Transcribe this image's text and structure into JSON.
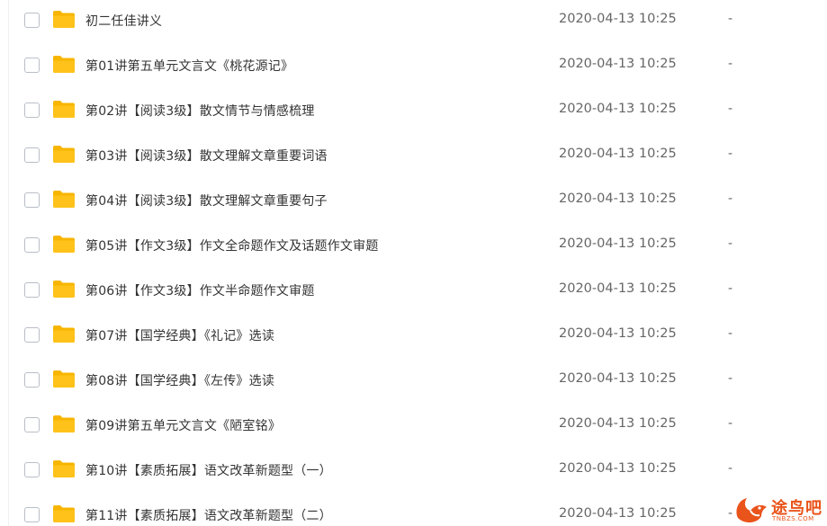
{
  "files": [
    {
      "name": "初二任佳讲义",
      "modified": "2020-04-13 10:25",
      "size": "-"
    },
    {
      "name": "第01讲第五单元文言文《桃花源记》",
      "modified": "2020-04-13 10:25",
      "size": "-"
    },
    {
      "name": "第02讲【阅读3级】散文情节与情感梳理",
      "modified": "2020-04-13 10:25",
      "size": "-"
    },
    {
      "name": "第03讲【阅读3级】散文理解文章重要词语",
      "modified": "2020-04-13 10:25",
      "size": "-"
    },
    {
      "name": "第04讲【阅读3级】散文理解文章重要句子",
      "modified": "2020-04-13 10:25",
      "size": "-"
    },
    {
      "name": "第05讲【作文3级】作文全命题作文及话题作文审题",
      "modified": "2020-04-13 10:25",
      "size": "-"
    },
    {
      "name": "第06讲【作文3级】作文半命题作文审题",
      "modified": "2020-04-13 10:25",
      "size": "-"
    },
    {
      "name": "第07讲【国学经典】《礼记》选读",
      "modified": "2020-04-13 10:25",
      "size": "-"
    },
    {
      "name": "第08讲【国学经典】《左传》选读",
      "modified": "2020-04-13 10:25",
      "size": "-"
    },
    {
      "name": "第09讲第五单元文言文《陋室铭》",
      "modified": "2020-04-13 10:25",
      "size": "-"
    },
    {
      "name": "第10讲【素质拓展】语文改革新题型（一）",
      "modified": "2020-04-13 10:25",
      "size": "-"
    },
    {
      "name": "第11讲【素质拓展】语文改革新题型（二）",
      "modified": "2020-04-13 10:25",
      "size": "-"
    }
  ],
  "watermark": {
    "text": "途鸟吧",
    "subtext": "TNBZS.COM"
  },
  "colors": {
    "folder": "#ffc21a",
    "folder_back": "#f7b500",
    "text": "#333333",
    "meta": "#666666",
    "watermark": "#e9541b"
  },
  "icons": {
    "folder": "folder-icon",
    "checkbox": "checkbox-icon"
  }
}
